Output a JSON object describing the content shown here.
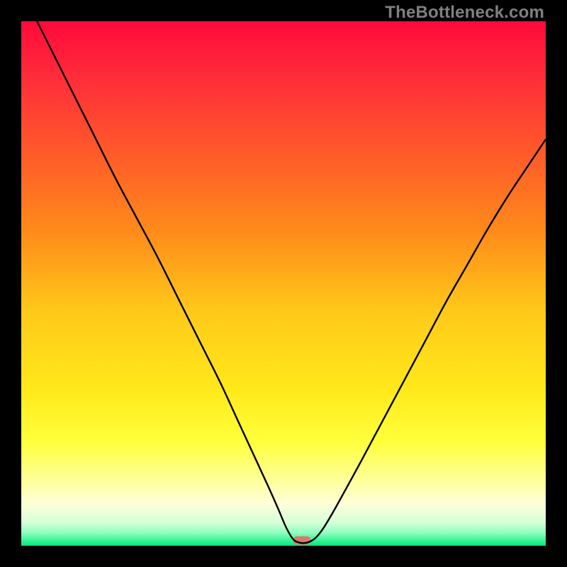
{
  "watermark": "TheBottleneck.com",
  "chart_data": {
    "type": "line",
    "title": "",
    "xlabel": "",
    "ylabel": "",
    "xlim": [
      0,
      100
    ],
    "ylim": [
      0,
      100
    ],
    "grid": false,
    "gradient_stops": [
      {
        "offset": 0.0,
        "color": "#ff0a3a"
      },
      {
        "offset": 0.1,
        "color": "#ff2a3a"
      },
      {
        "offset": 0.25,
        "color": "#ff5a2a"
      },
      {
        "offset": 0.4,
        "color": "#ff8a1a"
      },
      {
        "offset": 0.55,
        "color": "#ffc81a"
      },
      {
        "offset": 0.7,
        "color": "#ffe81a"
      },
      {
        "offset": 0.8,
        "color": "#ffff3a"
      },
      {
        "offset": 0.88,
        "color": "#feffa0"
      },
      {
        "offset": 0.92,
        "color": "#fdffd8"
      },
      {
        "offset": 0.955,
        "color": "#d8ffd8"
      },
      {
        "offset": 0.975,
        "color": "#90ffc0"
      },
      {
        "offset": 1.0,
        "color": "#00e87a"
      }
    ],
    "marker": {
      "x": 53.5,
      "y": 1.0,
      "width": 3.4,
      "height": 1.6,
      "color": "#d87a6a"
    },
    "series": [
      {
        "name": "bottleneck-curve",
        "points": [
          {
            "x": 3.0,
            "y": 100.0
          },
          {
            "x": 6.0,
            "y": 94.0
          },
          {
            "x": 10.0,
            "y": 86.0
          },
          {
            "x": 14.0,
            "y": 78.0
          },
          {
            "x": 18.0,
            "y": 70.0
          },
          {
            "x": 22.0,
            "y": 62.5
          },
          {
            "x": 26.0,
            "y": 55.0
          },
          {
            "x": 30.0,
            "y": 47.0
          },
          {
            "x": 34.0,
            "y": 39.0
          },
          {
            "x": 38.0,
            "y": 31.0
          },
          {
            "x": 41.0,
            "y": 24.5
          },
          {
            "x": 44.0,
            "y": 18.0
          },
          {
            "x": 47.0,
            "y": 11.5
          },
          {
            "x": 49.0,
            "y": 7.0
          },
          {
            "x": 50.5,
            "y": 3.5
          },
          {
            "x": 51.8,
            "y": 1.3
          },
          {
            "x": 53.0,
            "y": 0.6
          },
          {
            "x": 54.5,
            "y": 0.6
          },
          {
            "x": 56.0,
            "y": 1.4
          },
          {
            "x": 57.5,
            "y": 3.2
          },
          {
            "x": 59.5,
            "y": 6.5
          },
          {
            "x": 62.0,
            "y": 11.0
          },
          {
            "x": 65.0,
            "y": 16.5
          },
          {
            "x": 69.0,
            "y": 24.0
          },
          {
            "x": 73.0,
            "y": 31.5
          },
          {
            "x": 77.0,
            "y": 39.0
          },
          {
            "x": 81.0,
            "y": 46.5
          },
          {
            "x": 85.0,
            "y": 53.5
          },
          {
            "x": 89.0,
            "y": 60.5
          },
          {
            "x": 93.0,
            "y": 67.0
          },
          {
            "x": 97.0,
            "y": 73.0
          },
          {
            "x": 100.0,
            "y": 77.5
          }
        ]
      }
    ]
  }
}
